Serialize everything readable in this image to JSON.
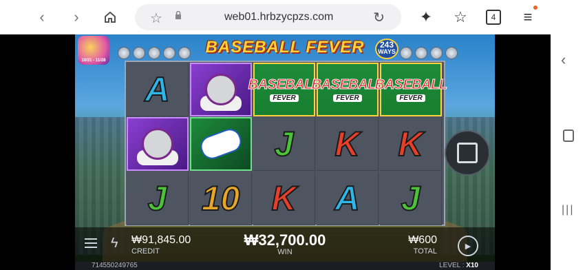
{
  "browser": {
    "url": "web01.hrbzycpzs.com",
    "tab_count": "4",
    "accent_dot": "#e8662a"
  },
  "game": {
    "title": "BASEBALL FEVER",
    "ways": {
      "number": "243",
      "label": "WAYS"
    },
    "promo": {
      "dates": "10/21 - 11/28"
    },
    "reels": [
      [
        {
          "type": "letter",
          "value": "A"
        },
        {
          "type": "catcher"
        },
        {
          "type": "letter",
          "value": "J"
        }
      ],
      [
        {
          "type": "catcher"
        },
        {
          "type": "player"
        },
        {
          "type": "letter",
          "value": "10"
        }
      ],
      [
        {
          "type": "wild",
          "line1": "BASEBALL",
          "line2": "FEVER"
        },
        {
          "type": "letter",
          "value": "J"
        },
        {
          "type": "letter",
          "value": "K"
        }
      ],
      [
        {
          "type": "wild",
          "line1": "BASEBALL",
          "line2": "FEVER"
        },
        {
          "type": "letter",
          "value": "K"
        },
        {
          "type": "letter",
          "value": "A"
        }
      ],
      [
        {
          "type": "wild",
          "line1": "BASEBALL",
          "line2": "FEVER"
        },
        {
          "type": "letter",
          "value": "K"
        },
        {
          "type": "letter",
          "value": "J"
        }
      ]
    ],
    "credit": {
      "value": "₩91,845.00",
      "label": "CREDIT"
    },
    "win": {
      "value": "₩32,700.00",
      "label": "WIN"
    },
    "total": {
      "value": "₩600",
      "label": "TOTAL"
    },
    "session_id": "714550249765",
    "level": {
      "label": "LEVEL :",
      "value": "X10"
    }
  }
}
